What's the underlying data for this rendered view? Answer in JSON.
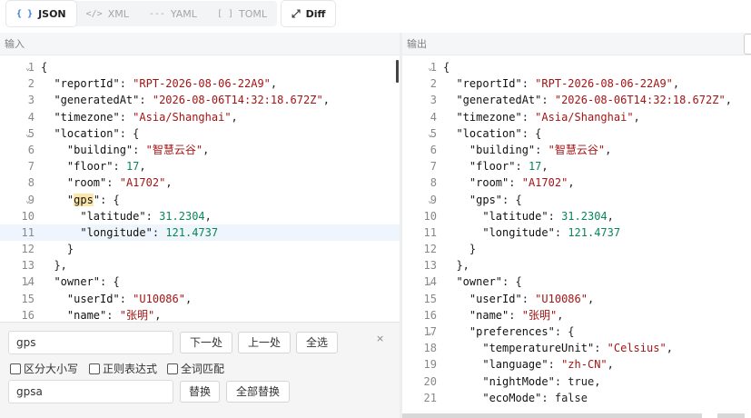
{
  "tabs": [
    {
      "icon": "{ }",
      "label": "JSON",
      "active": true
    },
    {
      "icon": "</>",
      "label": "XML"
    },
    {
      "icon": "---",
      "label": "YAML"
    },
    {
      "icon": "[ ]",
      "label": "TOML"
    },
    {
      "icon": "⤢",
      "label": "Diff"
    }
  ],
  "left_panel": {
    "title": "输入"
  },
  "right_panel": {
    "title": "输出"
  },
  "left_lines": [
    {
      "n": "1",
      "fold": true,
      "t": "{"
    },
    {
      "n": "2",
      "t": "  \"reportId\": \"RPT-2026-08-06-22A9\","
    },
    {
      "n": "3",
      "t": "  \"generatedAt\": \"2026-08-06T14:32:18.672Z\","
    },
    {
      "n": "4",
      "t": "  \"timezone\": \"Asia/Shanghai\","
    },
    {
      "n": "5",
      "fold": true,
      "t": "  \"location\": {"
    },
    {
      "n": "6",
      "t": "    \"building\": \"智慧云谷\","
    },
    {
      "n": "7",
      "t": "    \"floor\": 17,"
    },
    {
      "n": "8",
      "t": "    \"room\": \"A1702\","
    },
    {
      "n": "9",
      "fold": true,
      "t": "    \"gps\": {"
    },
    {
      "n": "10",
      "t": "      \"latitude\": 31.2304,"
    },
    {
      "n": "11",
      "t": "      \"longitude\": 121.4737"
    },
    {
      "n": "12",
      "t": "    }"
    },
    {
      "n": "13",
      "t": "  },"
    },
    {
      "n": "14",
      "fold": true,
      "t": "  \"owner\": {"
    },
    {
      "n": "15",
      "t": "    \"userId\": \"U10086\","
    },
    {
      "n": "16",
      "t": "    \"name\": \"张明\","
    }
  ],
  "right_lines": [
    {
      "n": "1",
      "fold": true,
      "t": "{"
    },
    {
      "n": "2",
      "t": "  \"reportId\": \"RPT-2026-08-06-22A9\","
    },
    {
      "n": "3",
      "t": "  \"generatedAt\": \"2026-08-06T14:32:18.672Z\","
    },
    {
      "n": "4",
      "t": "  \"timezone\": \"Asia/Shanghai\","
    },
    {
      "n": "5",
      "fold": true,
      "t": "  \"location\": {"
    },
    {
      "n": "6",
      "t": "    \"building\": \"智慧云谷\","
    },
    {
      "n": "7",
      "t": "    \"floor\": 17,"
    },
    {
      "n": "8",
      "t": "    \"room\": \"A1702\","
    },
    {
      "n": "9",
      "fold": true,
      "t": "    \"gps\": {"
    },
    {
      "n": "10",
      "t": "      \"latitude\": 31.2304,"
    },
    {
      "n": "11",
      "t": "      \"longitude\": 121.4737"
    },
    {
      "n": "12",
      "t": "    }"
    },
    {
      "n": "13",
      "t": "  },"
    },
    {
      "n": "14",
      "fold": true,
      "t": "  \"owner\": {"
    },
    {
      "n": "15",
      "t": "    \"userId\": \"U10086\","
    },
    {
      "n": "16",
      "t": "    \"name\": \"张明\","
    },
    {
      "n": "17",
      "fold": true,
      "t": "    \"preferences\": {"
    },
    {
      "n": "18",
      "t": "      \"temperatureUnit\": \"Celsius\","
    },
    {
      "n": "19",
      "t": "      \"language\": \"zh-CN\","
    },
    {
      "n": "20",
      "t": "      \"nightMode\": true,"
    },
    {
      "n": "21",
      "t": "      \"ecoMode\": false"
    }
  ],
  "find": {
    "search_value": "gps",
    "replace_value": "gpsa",
    "next_label": "下一处",
    "prev_label": "上一处",
    "all_label": "全选",
    "case_label": "区分大小写",
    "regex_label": "正则表达式",
    "word_label": "全词匹配",
    "replace_label": "替换",
    "replace_all_label": "全部替换",
    "close_icon": "×"
  },
  "colors": {
    "key": "#111111",
    "string": "#a31515",
    "number": "#098658",
    "bool": "#0000ff",
    "active_line": "#eef5fd",
    "match": "#fde6a8"
  }
}
